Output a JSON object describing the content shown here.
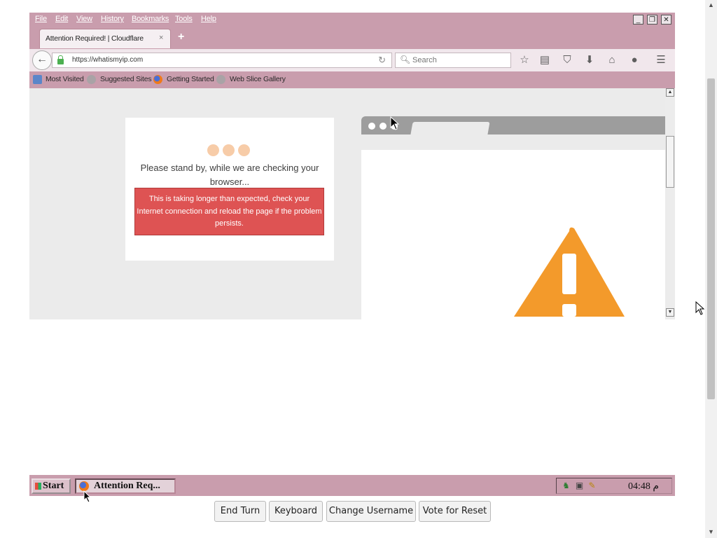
{
  "firefox": {
    "menu": [
      "File",
      "Edit",
      "View",
      "History",
      "Bookmarks",
      "Tools",
      "Help"
    ],
    "window_buttons": {
      "minimize": "_",
      "restore": "❐",
      "close": "✕"
    },
    "tab": {
      "title": "Attention Required! | Cloudflare",
      "close": "×",
      "new_tab": "+"
    },
    "url": "https://whatismyip.com",
    "search_placeholder": "Search",
    "bookmarks": [
      "Most Visited",
      "Suggested Sites",
      "Getting Started",
      "Web Slice Gallery"
    ],
    "toolbar_icons": [
      "star-icon",
      "reading-list-icon",
      "pocket-icon",
      "download-icon",
      "home-icon",
      "chat-icon",
      "menu-icon"
    ]
  },
  "cloudflare": {
    "message": "Please stand by, while we are checking your browser...",
    "alert": "This is taking longer than expected, check your Internet connection and reload the page if the problem persists."
  },
  "taskbar": {
    "start_label": "Start",
    "task_label": "Attention Req...",
    "clock": "04:48 م"
  },
  "controls": {
    "end_turn": "End Turn",
    "keyboard": "Keyboard",
    "change_username": "Change Username",
    "vote_reset": "Vote for Reset"
  },
  "colors": {
    "chrome_pink": "#c99dad",
    "alert_red": "#de5353",
    "warning_orange": "#f39a2b",
    "loading_dots": "#f7cca8"
  }
}
